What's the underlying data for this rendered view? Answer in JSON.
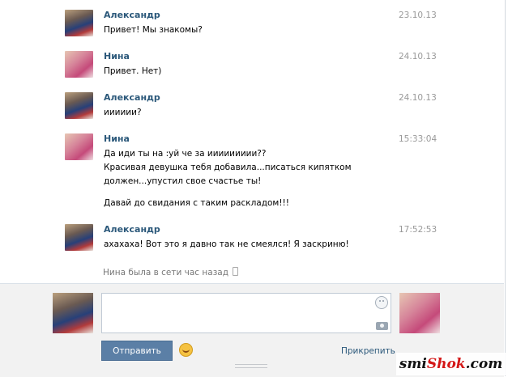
{
  "messages": [
    {
      "author": "Александр",
      "date": "23.10.13",
      "gender": "m",
      "lines": [
        "Привет! Мы знакомы?"
      ]
    },
    {
      "author": "Нина",
      "date": "24.10.13",
      "gender": "f",
      "lines": [
        "Привет. Нет)"
      ]
    },
    {
      "author": "Александр",
      "date": "24.10.13",
      "gender": "m",
      "lines": [
        "ииииии?"
      ]
    },
    {
      "author": "Нина",
      "date": "15:33:04",
      "gender": "f",
      "lines": [
        "Да иди ты на :уй че за иииииииии??",
        "Красивая девушка тебя добавила...писаться кипятком",
        "должен...упустил свое счастье ты!",
        "",
        "Давай до свидания с таким раскладом!!!"
      ]
    },
    {
      "author": "Александр",
      "date": "17:52:53",
      "gender": "m",
      "lines": [
        "ахахаха! Вот это я давно так не смеялся! Я заскриню!"
      ]
    }
  ],
  "status": {
    "text": "Нина была в сети час назад",
    "icon": "mobile-phone-icon"
  },
  "composer": {
    "input_value": "",
    "send_label": "Отправить",
    "attach_label": "Прикрепить",
    "emoji_icon": "smile-emoji-icon"
  },
  "watermark": {
    "prefix": "smi",
    "brand": "Shok",
    "suffix": ".com"
  },
  "colors": {
    "author": "#2b587a",
    "send_button": "#5b7fa6",
    "panel": "#f2f2f2",
    "watermark_accent": "#d41717"
  }
}
